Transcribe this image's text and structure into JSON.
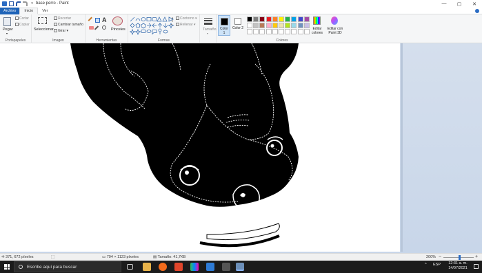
{
  "window": {
    "title": "base perro - Paint",
    "controls": [
      "—",
      "▢",
      "✕"
    ]
  },
  "tabs": [
    {
      "label": "Archivo"
    },
    {
      "label": "Inicio"
    },
    {
      "label": "Ver"
    }
  ],
  "ribbon": {
    "clipboard": {
      "paste": "Pegar",
      "cut": "Cortar",
      "copy": "Copiar",
      "label": "Portapapeles"
    },
    "image": {
      "select": "Seleccionar",
      "crop": "Recortar",
      "resize": "Cambiar tamaño",
      "rotate": "Girar",
      "label": "Imagen"
    },
    "tools": {
      "brushes": "Pinceles",
      "label": "Herramientas"
    },
    "shapes": {
      "outline": "Contorno",
      "fill": "Rellenar",
      "label": "Formas"
    },
    "size": {
      "label": "Tamaño"
    },
    "colors": {
      "color1": "Color 1",
      "color2": "Color 2",
      "edit": "Editar colores",
      "paint3d": "Editar con Paint 3D",
      "label": "Colores",
      "palette_row1": [
        "#000000",
        "#7f7f7f",
        "#880015",
        "#ed1c24",
        "#ff7f27",
        "#fff200",
        "#22b14c",
        "#00a2e8",
        "#3f48cc",
        "#a349a4"
      ],
      "palette_row2": [
        "#ffffff",
        "#c3c3c3",
        "#b97a57",
        "#ffaec9",
        "#ffc90e",
        "#efe4b0",
        "#b5e61d",
        "#99d9ea",
        "#7092be",
        "#c8bfe7"
      ]
    }
  },
  "status": {
    "cursor": "371, 672 píxeles",
    "dimensions": "794 × 1123 píxeles",
    "filesize": "Tamaño: 41,7KB",
    "zoom": "200%"
  },
  "taskbar": {
    "search_placeholder": "Escribe aquí para buscar",
    "lang": "ESP",
    "time": "12:31 a. m.",
    "date": "14/07/2021"
  }
}
